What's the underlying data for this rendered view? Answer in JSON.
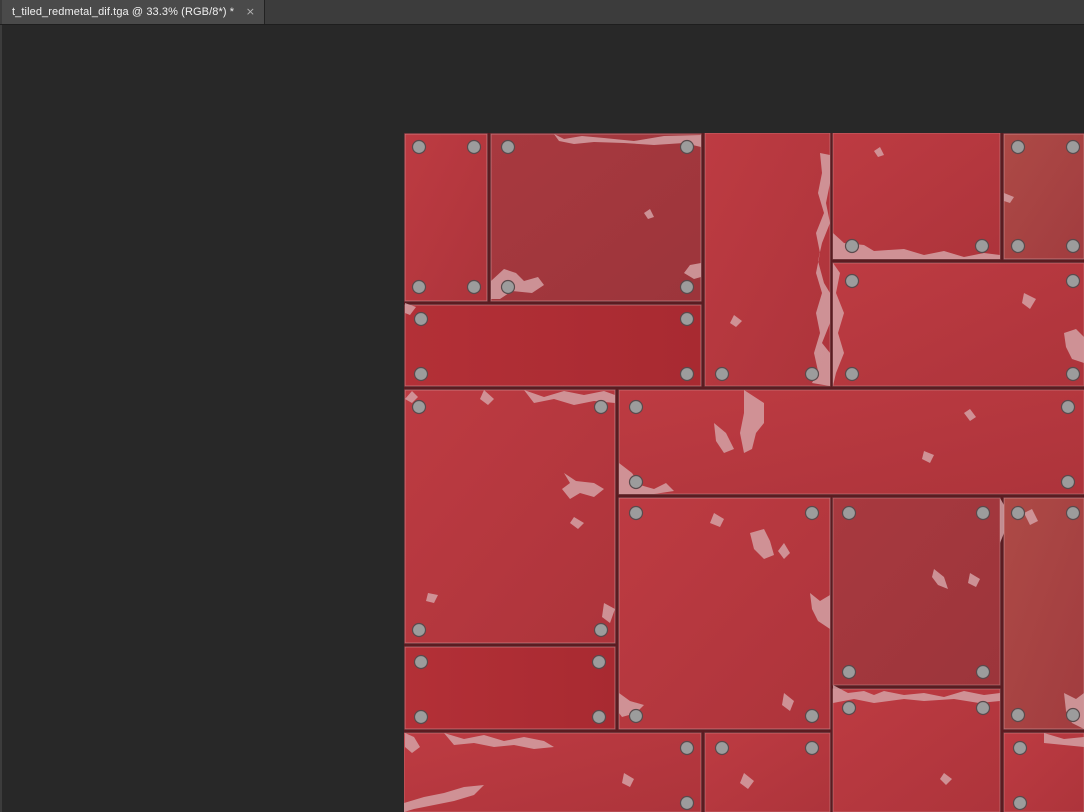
{
  "document_tab": {
    "title": "t_tiled_redmetal_dif.tga @ 33.3% (RGB/8*) *",
    "close_glyph": "×"
  },
  "image": {
    "name": "t_tiled_redmetal_dif.tga",
    "zoom": "33.3%",
    "mode": "RGB/8*",
    "colors": {
      "panel_red": "#b83a40",
      "panel_dark": "#a0343a",
      "seam": "#5a1c21",
      "chip": "#d9a0a4",
      "rivet": "#9a9a9a"
    }
  },
  "icons": {
    "close": "close-icon"
  },
  "colors": {
    "workspace": "#282828",
    "tab_bar": "#3c3c3c",
    "active_tab": "#4a4a4a",
    "tab_text": "#f0f0f0"
  }
}
